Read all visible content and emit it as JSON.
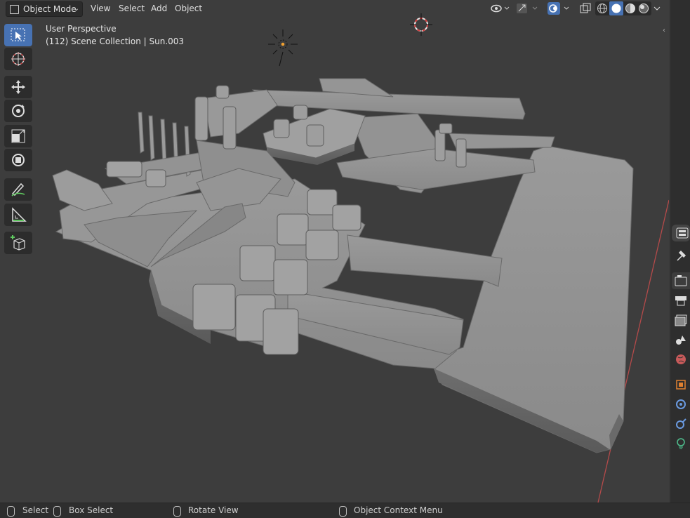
{
  "header": {
    "mode_label": "Object Mode",
    "menus": [
      "View",
      "Select",
      "Add",
      "Object"
    ]
  },
  "overlay": {
    "perspective": "User Perspective",
    "collection": "(112) Scene Collection | Sun.003"
  },
  "toolbar": {
    "tools": [
      "select-box",
      "cursor",
      "move",
      "rotate",
      "scale",
      "transform",
      "annotate",
      "measure",
      "add-cube"
    ],
    "active": "select-box"
  },
  "header_right": {
    "icons": [
      "visibility-icon",
      "gizmo-icon",
      "overlays-icon",
      "xray-icon",
      "wireframe-shading-icon",
      "solid-shading-icon",
      "material-shading-icon",
      "rendered-shading-icon"
    ],
    "active_shading": "solid"
  },
  "properties_tabs": [
    "tool-icon",
    "render-icon",
    "output-icon",
    "view-layer-icon",
    "scene-icon",
    "world-icon",
    "object-icon",
    "modifiers-icon",
    "physics-icon",
    "constraints-icon"
  ],
  "status": {
    "select": "Select",
    "box_select": "Box Select",
    "rotate_view": "Rotate View",
    "context_menu": "Object Context Menu"
  },
  "colors": {
    "accent": "#4772b3",
    "viewport_bg": "#3d3d3d",
    "mesh": "#8c8c8c"
  }
}
